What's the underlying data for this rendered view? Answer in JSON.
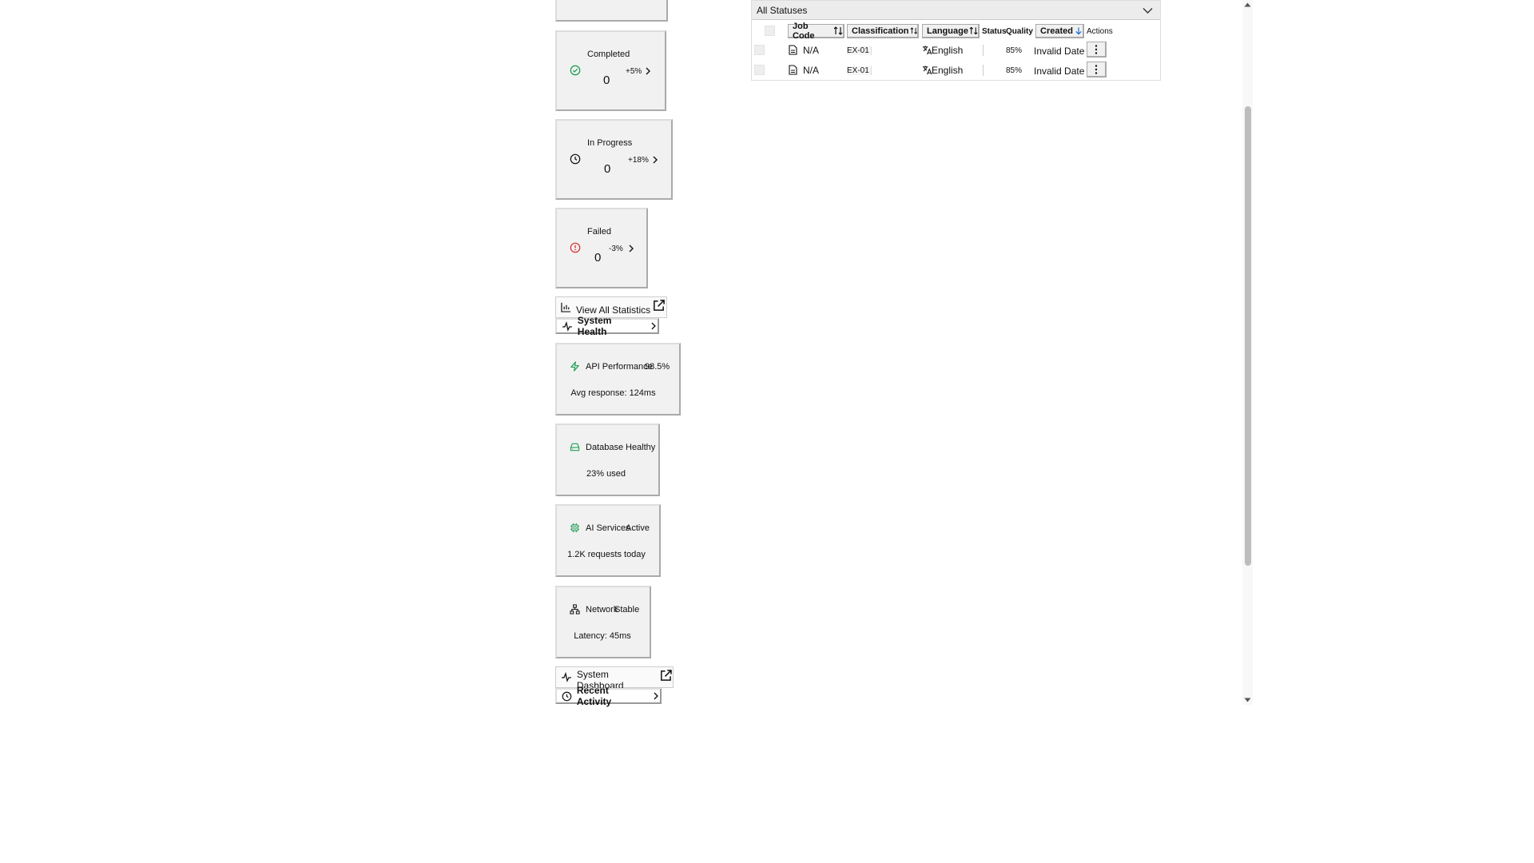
{
  "stats": {
    "completed": {
      "title": "Completed",
      "value": "0",
      "change": "+5%"
    },
    "in_progress": {
      "title": "In Progress",
      "value": "0",
      "change": "+18%"
    },
    "failed": {
      "title": "Failed",
      "value": "0",
      "change": "-3%"
    },
    "view_all_label": "View All Statistics"
  },
  "health": {
    "section_label": "System Health",
    "api": {
      "name": "API Performance",
      "status": "98.5%",
      "detail": "Avg response: 124ms"
    },
    "database": {
      "name": "Database",
      "status": "Healthy",
      "detail": "23% used"
    },
    "ai": {
      "name": "AI Services",
      "status": "Active",
      "detail": "1.2K requests today"
    },
    "network": {
      "name": "Network",
      "status": "Stable",
      "detail": "Latency: 45ms"
    },
    "dashboard_label": "System Dashboard"
  },
  "recent_activity_label": "Recent Activity",
  "jobs": {
    "filter_value": "All Statuses",
    "columns": {
      "job_code": "Job Code",
      "classification": "Classification",
      "language": "Language",
      "status": "Status",
      "quality": "Quality",
      "created": "Created",
      "actions": "Actions"
    },
    "rows": [
      {
        "job_code": "N/A",
        "classification": "EX-01",
        "language": "English",
        "quality": "85%",
        "created": "Invalid Date"
      },
      {
        "job_code": "N/A",
        "classification": "EX-01",
        "language": "English",
        "quality": "85%",
        "created": "Invalid Date"
      }
    ]
  },
  "colors": {
    "success": "#22a05a",
    "danger": "#d93030",
    "accent": "#1a6fd8"
  }
}
